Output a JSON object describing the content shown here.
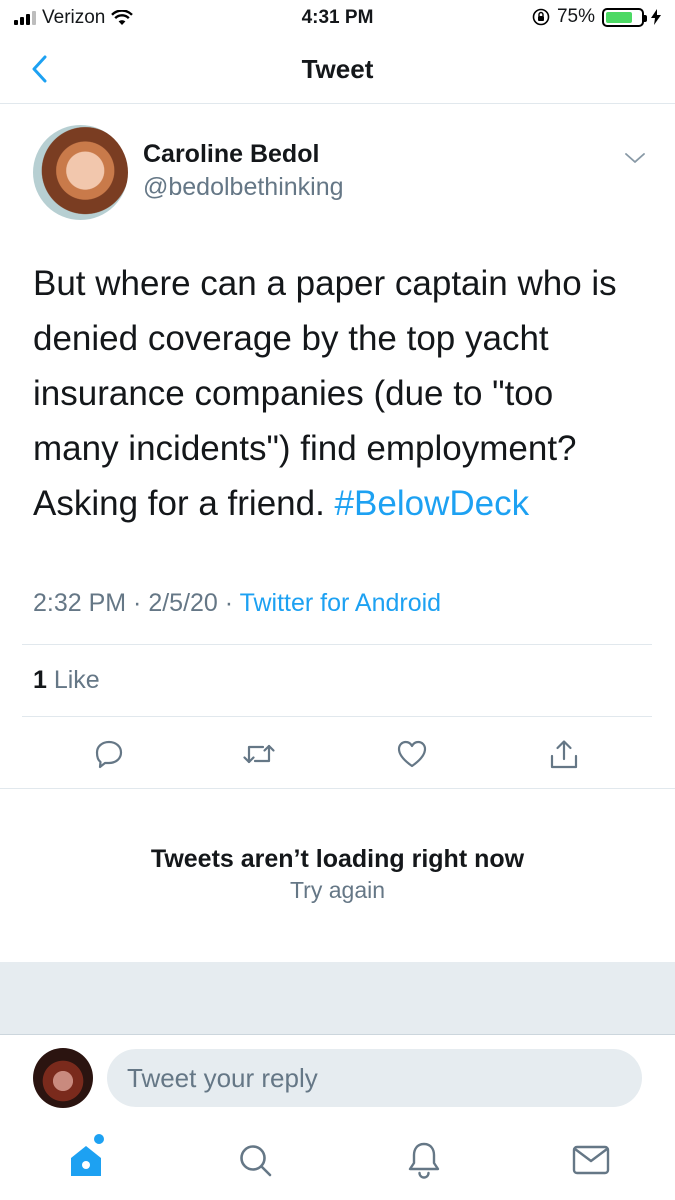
{
  "status_bar": {
    "carrier": "Verizon",
    "time": "4:31 PM",
    "battery_percent": "75%",
    "battery_level": 0.75,
    "battery_color": "#4cd964"
  },
  "header": {
    "title": "Tweet",
    "back_icon": "chevron-left-icon"
  },
  "tweet": {
    "author_name": "Caroline Bedol",
    "author_handle": "@bedolbethinking",
    "text": "But where can a paper captain who is denied coverage by the top yacht insurance companies (due to \"too many incidents\") find employment? Asking for a friend. ",
    "hashtag": "#BelowDeck",
    "time": "2:32 PM",
    "separator": " · ",
    "date": "2/5/20",
    "source": "Twitter for Android",
    "like_count": "1",
    "like_label": " Like",
    "actions": [
      "reply-icon",
      "retweet-icon",
      "heart-icon",
      "share-icon"
    ]
  },
  "replies": {
    "error_title": "Tweets aren’t loading right now",
    "retry_label": "Try again"
  },
  "composer": {
    "placeholder": "Tweet your reply"
  },
  "tab_bar": {
    "tabs": [
      "home-icon",
      "search-icon",
      "bell-icon",
      "mail-icon"
    ]
  },
  "colors": {
    "accent": "#1da1f2",
    "secondary_text": "#657786",
    "border": "#e1e8ed",
    "band": "#e6ecf0"
  }
}
